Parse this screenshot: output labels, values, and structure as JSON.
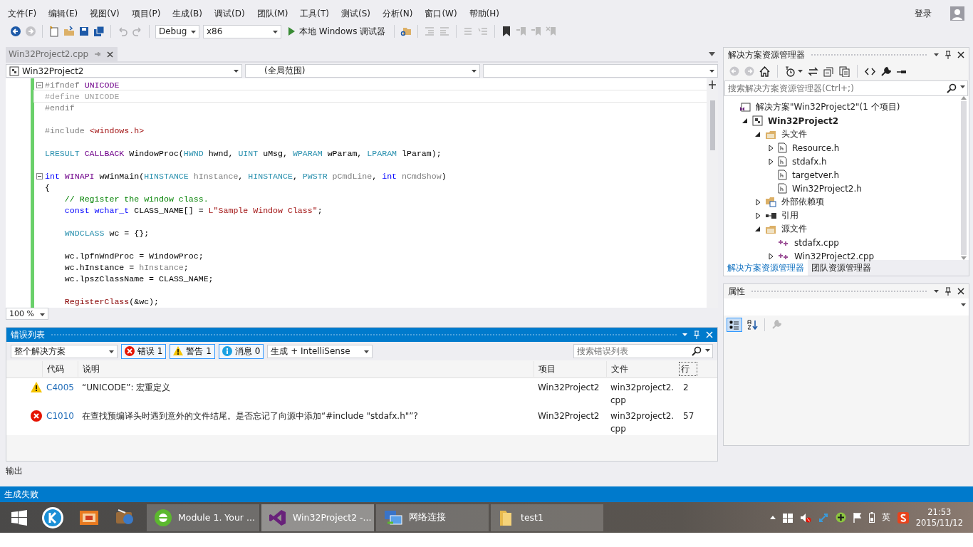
{
  "menu": [
    "文件(F)",
    "编辑(E)",
    "视图(V)",
    "项目(P)",
    "生成(B)",
    "调试(D)",
    "团队(M)",
    "工具(T)",
    "测试(S)",
    "分析(N)",
    "窗口(W)",
    "帮助(H)"
  ],
  "account": {
    "sign_in": "登录"
  },
  "toolbar": {
    "configuration": "Debug",
    "platform": "x86",
    "run_button": "本地 Windows 调试器"
  },
  "editor": {
    "tab": {
      "title": "Win32Project2.cpp"
    },
    "project_dropdown": "Win32Project2",
    "scope_dropdown": "(全局范围)",
    "zoom": "100 %",
    "lines": [
      {
        "kind": "code",
        "fold": true,
        "tokens": [
          {
            "kind": "pp",
            "text": "#ifndef "
          },
          {
            "kind": "macro",
            "text": "UNICODE"
          }
        ]
      },
      {
        "kind": "code",
        "fold": false,
        "tokens": [
          {
            "kind": "inactive",
            "text": "#define UNICODE"
          }
        ]
      },
      {
        "kind": "code",
        "fold": false,
        "tokens": [
          {
            "kind": "pp",
            "text": "#endif"
          }
        ]
      },
      {
        "kind": "blank"
      },
      {
        "kind": "code",
        "fold": false,
        "tokens": [
          {
            "kind": "pp",
            "text": "#include "
          },
          {
            "kind": "string",
            "text": "<windows.h>"
          }
        ]
      },
      {
        "kind": "blank"
      },
      {
        "kind": "code",
        "fold": false,
        "tokens": [
          {
            "kind": "type",
            "text": "LRESULT"
          },
          {
            "kind": "macro",
            "text": " CALLBACK"
          },
          {
            "kind": "plain",
            "text": " WindowProc("
          },
          {
            "kind": "type",
            "text": "HWND"
          },
          {
            "kind": "plain",
            "text": " hwnd, "
          },
          {
            "kind": "type",
            "text": "UINT"
          },
          {
            "kind": "plain",
            "text": " uMsg, "
          },
          {
            "kind": "type",
            "text": "WPARAM"
          },
          {
            "kind": "plain",
            "text": " wParam, "
          },
          {
            "kind": "type",
            "text": "LPARAM"
          },
          {
            "kind": "plain",
            "text": " lParam);"
          }
        ]
      },
      {
        "kind": "blank"
      },
      {
        "kind": "code",
        "fold": true,
        "tokens": [
          {
            "kind": "keyword",
            "text": "int"
          },
          {
            "kind": "macro",
            "text": " WINAPI"
          },
          {
            "kind": "plain",
            "text": " wWinMain("
          },
          {
            "kind": "type",
            "text": "HINSTANCE"
          },
          {
            "kind": "param",
            "text": " hInstance"
          },
          {
            "kind": "plain",
            "text": ", "
          },
          {
            "kind": "type",
            "text": "HINSTANCE"
          },
          {
            "kind": "plain",
            "text": ", "
          },
          {
            "kind": "type",
            "text": "PWSTR"
          },
          {
            "kind": "param",
            "text": " pCmdLine"
          },
          {
            "kind": "plain",
            "text": ", "
          },
          {
            "kind": "keyword",
            "text": "int"
          },
          {
            "kind": "param",
            "text": " nCmdShow"
          },
          {
            "kind": "plain",
            "text": ")"
          }
        ]
      },
      {
        "kind": "code",
        "fold": false,
        "tokens": [
          {
            "kind": "plain",
            "text": "{"
          }
        ]
      },
      {
        "kind": "code",
        "fold": false,
        "tokens": [
          {
            "kind": "comment",
            "text": "    // Register the window class."
          }
        ]
      },
      {
        "kind": "code",
        "fold": false,
        "tokens": [
          {
            "kind": "keyword",
            "text": "    const wchar_t"
          },
          {
            "kind": "plain",
            "text": " CLASS_NAME[] = "
          },
          {
            "kind": "string",
            "text": "L\"Sample Window Class\""
          },
          {
            "kind": "plain",
            "text": ";"
          }
        ]
      },
      {
        "kind": "blank"
      },
      {
        "kind": "code",
        "fold": false,
        "tokens": [
          {
            "kind": "type",
            "text": "    WNDCLASS"
          },
          {
            "kind": "plain",
            "text": " wc = {};"
          }
        ]
      },
      {
        "kind": "blank"
      },
      {
        "kind": "code",
        "fold": false,
        "tokens": [
          {
            "kind": "plain",
            "text": "    wc.lpfnWndProc = WindowProc;"
          }
        ]
      },
      {
        "kind": "code",
        "fold": false,
        "tokens": [
          {
            "kind": "plain",
            "text": "    wc.hInstance = "
          },
          {
            "kind": "param",
            "text": "hInstance"
          },
          {
            "kind": "plain",
            "text": ";"
          }
        ]
      },
      {
        "kind": "code",
        "fold": false,
        "tokens": [
          {
            "kind": "plain",
            "text": "    wc.lpszClassName = CLASS_NAME;"
          }
        ]
      },
      {
        "kind": "blank"
      },
      {
        "kind": "code",
        "fold": false,
        "tokens": [
          {
            "kind": "function",
            "text": "    RegisterClass"
          },
          {
            "kind": "plain",
            "text": "(&wc);"
          }
        ]
      }
    ]
  },
  "solution_explorer": {
    "title": "解决方案资源管理器",
    "search": {
      "placeholder": "搜索解决方案资源管理器(Ctrl+;)"
    },
    "tree": [
      {
        "kind": "solution",
        "label": "解决方案\"Win32Project2\"(1 个项目)",
        "children": [
          {
            "kind": "project",
            "label": "Win32Project2",
            "expanded": true,
            "children": [
              {
                "kind": "folder",
                "label": "头文件",
                "expanded": true,
                "children": [
                  {
                    "kind": "header",
                    "label": "Resource.h",
                    "expanded": false
                  },
                  {
                    "kind": "header",
                    "label": "stdafx.h",
                    "expanded": false
                  },
                  {
                    "kind": "header",
                    "label": "targetver.h"
                  },
                  {
                    "kind": "header",
                    "label": "Win32Project2.h"
                  }
                ]
              },
              {
                "kind": "deps",
                "label": "外部依赖项",
                "expanded": false
              },
              {
                "kind": "refs",
                "label": "引用",
                "expanded": false
              },
              {
                "kind": "folder",
                "label": "源文件",
                "expanded": true,
                "children": [
                  {
                    "kind": "cpp",
                    "label": "stdafx.cpp"
                  },
                  {
                    "kind": "cpp",
                    "label": "Win32Project2.cpp",
                    "expanded": false
                  }
                ]
              }
            ]
          }
        ]
      }
    ],
    "tabs": [
      {
        "label": "解决方案资源管理器",
        "selected": true
      },
      {
        "label": "团队资源管理器",
        "selected": false
      }
    ]
  },
  "properties": {
    "title": "属性"
  },
  "error_list": {
    "title": "错误列表",
    "scope": "整个解决方案",
    "filters": [
      {
        "kind": "error",
        "label": "错误 1",
        "selected": true
      },
      {
        "kind": "warning",
        "label": "警告 1",
        "selected": true
      },
      {
        "kind": "info",
        "label": "消息 0",
        "selected": true
      }
    ],
    "source": "生成 + IntelliSense",
    "search": {
      "placeholder": "搜索错误列表"
    },
    "columns": [
      "代码",
      "说明",
      "项目",
      "文件",
      "行"
    ],
    "rows": [
      {
        "kind": "warning",
        "code": "C4005",
        "description": "“UNICODE”: 宏重定义",
        "project": "Win32Project2",
        "file": "win32project2.cpp",
        "line": "2"
      },
      {
        "kind": "error",
        "code": "C1010",
        "description": "在查找预编译头时遇到意外的文件结尾。是否忘记了向源中添加“#include \"stdafx.h\"”?",
        "project": "Win32Project2",
        "file": "win32project2.cpp",
        "line": "57"
      }
    ]
  },
  "output_tab": "输出",
  "status_bar": "生成失败",
  "taskbar": {
    "windows": [
      {
        "kind": "browser",
        "title": "Module 1. Your ...",
        "selected": false
      },
      {
        "kind": "vs",
        "title": "Win32Project2 -...",
        "selected": true
      },
      {
        "kind": "network",
        "title": "网络连接",
        "selected": false
      },
      {
        "kind": "folder",
        "title": "test1",
        "selected": false
      }
    ],
    "ime": "英",
    "time": "21:53",
    "date": "2015/11/12"
  }
}
